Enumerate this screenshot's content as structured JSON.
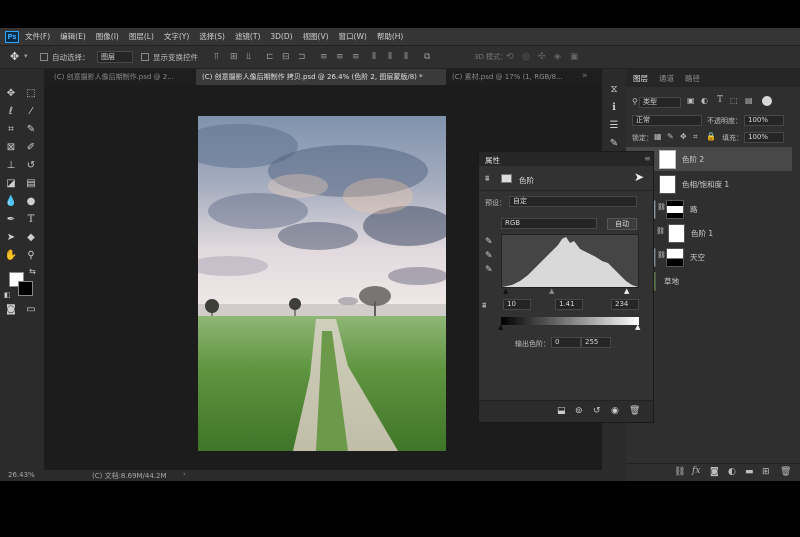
{
  "app": {
    "logo": "Ps"
  },
  "menu": [
    "文件(F)",
    "编辑(E)",
    "图像(I)",
    "图层(L)",
    "文字(Y)",
    "选择(S)",
    "滤镜(T)",
    "3D(D)",
    "视图(V)",
    "窗口(W)",
    "帮助(H)"
  ],
  "options": {
    "auto_select_label": "自动选择：",
    "auto_select_value": "图层",
    "show_transform_label": "显示变换控件",
    "mode_3d_label": "3D 模式："
  },
  "tabs": [
    {
      "label": "(C) 创意摄影人像后期制作.psd @ 2..."
    },
    {
      "label": "(C) 创意摄影人像后期制作 拷贝.psd @ 26.4% (色阶 2, 图层蒙版/8) *"
    },
    {
      "label": "(C) 素材.psd @ 17% (1, RGB/8..."
    }
  ],
  "status": {
    "zoom": "26.43%",
    "doc": "(C) 文档:8.69M/44.2M"
  },
  "properties": {
    "title": "属性",
    "adjustment_name": "色阶",
    "preset_label": "预设：",
    "preset_value": "自定",
    "channel_value": "RGB",
    "auto_button": "自动",
    "input_black": "10",
    "input_gamma": "1.41",
    "input_white": "234",
    "output_label": "输出色阶：",
    "output_black": "0",
    "output_white": "255"
  },
  "layers_panel": {
    "tabs": [
      "图层",
      "通道",
      "路径"
    ],
    "filter_value": "类型",
    "blend_mode": "正常",
    "opacity_label": "不透明度：",
    "opacity_value": "100%",
    "lock_label": "锁定：",
    "fill_label": "填充：",
    "fill_value": "100%",
    "layers": [
      {
        "name": "色阶 2"
      },
      {
        "name": "色相/饱和度 1"
      },
      {
        "name": "路"
      },
      {
        "name": "色阶 1"
      },
      {
        "name": "天空"
      },
      {
        "name": "草地"
      }
    ]
  },
  "colors": {
    "accent": "#31a8ff",
    "panel": "#2f2f2f",
    "canvas_bg": "#1c1c1c"
  }
}
